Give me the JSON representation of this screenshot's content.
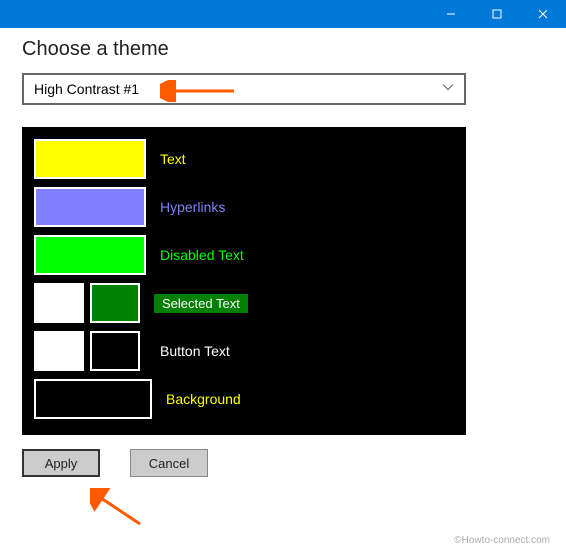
{
  "window": {
    "minimize": "—",
    "maximize": "▢",
    "close": "✕"
  },
  "heading": "Choose a theme",
  "theme_select": {
    "value": "High Contrast #1"
  },
  "preview": {
    "text_label": "Text",
    "hyperlinks_label": "Hyperlinks",
    "disabled_label": "Disabled Text",
    "selected_label": "Selected Text",
    "button_label": "Button Text",
    "background_label": "Background",
    "colors": {
      "text": "#ffff00",
      "hyperlinks": "#8080ff",
      "disabled": "#00ff00",
      "selected_fg": "#ffffff",
      "selected_bg": "#008000",
      "button_fg": "#ffffff",
      "button_bg": "#000000",
      "background": "#000000"
    }
  },
  "buttons": {
    "apply": "Apply",
    "cancel": "Cancel"
  },
  "watermark": "©Howto-connect.com"
}
